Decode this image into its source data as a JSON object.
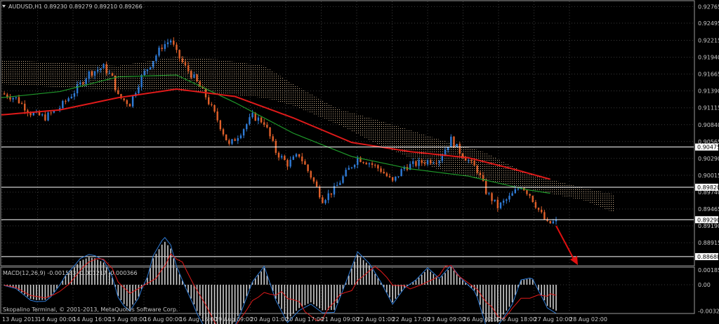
{
  "chart_data": [
    {
      "type": "candlestick",
      "title": "AUDUSD,H1  0.89230 0.89279 0.89210 0.89266",
      "symbol": "AUDUSD,H1",
      "ohlc_readout": "0.89230 0.89279 0.89210 0.89266",
      "ylim": [
        0.8855,
        0.9285
      ],
      "y_ticks": [
        "0.92765",
        "0.92495",
        "0.92215",
        "0.91940",
        "0.91665",
        "0.91390",
        "0.91115",
        "0.90840",
        "0.90565",
        "0.90290",
        "0.90015",
        "0.89740",
        "0.89465",
        "0.89190",
        "0.88915"
      ],
      "horizontal_levels": [
        "0.90475",
        "0.89820",
        "0.89290",
        "0.88688"
      ],
      "x_labels": [
        "13 Aug 2013",
        "14 Aug 00:00",
        "14 Aug 16:00",
        "15 Aug 08:00",
        "16 Aug 00:00",
        "16 Aug 16:00",
        "19 Aug 09:00",
        "20 Aug 01:00",
        "20 Aug 17:00",
        "21 Aug 09:00",
        "22 Aug 01:00",
        "22 Aug 17:00",
        "23 Aug 09:00",
        "26 Aug 02:00",
        "26 Aug 18:00",
        "27 Aug 10:00",
        "28 Aug 02:00"
      ],
      "indicators": [
        "Ichimoku cloud",
        "Moving average (red)",
        "Moving average (green)"
      ],
      "close_path": [
        [
          0,
          0.9135
        ],
        [
          5,
          0.9127
        ],
        [
          10,
          0.9103
        ],
        [
          15,
          0.9096
        ],
        [
          20,
          0.9112
        ],
        [
          25,
          0.9138
        ],
        [
          30,
          0.9168
        ],
        [
          35,
          0.9178
        ],
        [
          38,
          0.916
        ],
        [
          40,
          0.913
        ],
        [
          44,
          0.9118
        ],
        [
          48,
          0.9162
        ],
        [
          52,
          0.919
        ],
        [
          55,
          0.9212
        ],
        [
          58,
          0.9222
        ],
        [
          60,
          0.92
        ],
        [
          63,
          0.9178
        ],
        [
          66,
          0.916
        ],
        [
          70,
          0.913
        ],
        [
          74,
          0.9092
        ],
        [
          78,
          0.905
        ],
        [
          82,
          0.9072
        ],
        [
          86,
          0.9098
        ],
        [
          90,
          0.9088
        ],
        [
          94,
          0.904
        ],
        [
          98,
          0.902
        ],
        [
          102,
          0.9035
        ],
        [
          106,
          0.9
        ],
        [
          110,
          0.8962
        ],
        [
          114,
          0.8978
        ],
        [
          118,
          0.9005
        ],
        [
          122,
          0.903
        ],
        [
          126,
          0.9022
        ],
        [
          130,
          0.901
        ],
        [
          134,
          0.899
        ],
        [
          138,
          0.9015
        ],
        [
          142,
          0.902
        ],
        [
          146,
          0.9025
        ],
        [
          150,
          0.9028
        ],
        [
          154,
          0.906
        ],
        [
          157,
          0.904
        ],
        [
          160,
          0.9025
        ],
        [
          163,
          0.901
        ],
        [
          166,
          0.8975
        ],
        [
          170,
          0.895
        ],
        [
          174,
          0.8965
        ],
        [
          178,
          0.8985
        ],
        [
          181,
          0.897
        ],
        [
          184,
          0.8945
        ],
        [
          187,
          0.8922
        ],
        [
          190,
          0.8926
        ]
      ],
      "ma_red": [
        [
          0,
          0.91
        ],
        [
          20,
          0.9108
        ],
        [
          40,
          0.9128
        ],
        [
          60,
          0.9142
        ],
        [
          80,
          0.913
        ],
        [
          100,
          0.9095
        ],
        [
          120,
          0.9055
        ],
        [
          140,
          0.904
        ],
        [
          160,
          0.903
        ],
        [
          175,
          0.9012
        ],
        [
          188,
          0.8995
        ]
      ],
      "ma_green": [
        [
          0,
          0.9128
        ],
        [
          20,
          0.9138
        ],
        [
          40,
          0.9162
        ],
        [
          60,
          0.9165
        ],
        [
          80,
          0.912
        ],
        [
          100,
          0.907
        ],
        [
          120,
          0.9032
        ],
        [
          140,
          0.9012
        ],
        [
          160,
          0.9
        ],
        [
          180,
          0.8978
        ],
        [
          188,
          0.8972
        ]
      ],
      "cloud_upper": [
        [
          0,
          0.919
        ],
        [
          20,
          0.9185
        ],
        [
          40,
          0.918
        ],
        [
          60,
          0.9195
        ],
        [
          75,
          0.919
        ],
        [
          90,
          0.918
        ],
        [
          100,
          0.915
        ],
        [
          115,
          0.911
        ],
        [
          130,
          0.909
        ],
        [
          150,
          0.906
        ],
        [
          165,
          0.904
        ],
        [
          180,
          0.9005
        ],
        [
          200,
          0.898
        ],
        [
          210,
          0.897
        ]
      ],
      "cloud_lower": [
        [
          0,
          0.915
        ],
        [
          20,
          0.9145
        ],
        [
          40,
          0.914
        ],
        [
          60,
          0.914
        ],
        [
          75,
          0.9135
        ],
        [
          90,
          0.9128
        ],
        [
          100,
          0.9115
        ],
        [
          115,
          0.9085
        ],
        [
          130,
          0.905
        ],
        [
          150,
          0.901
        ],
        [
          165,
          0.8995
        ],
        [
          180,
          0.898
        ],
        [
          200,
          0.896
        ],
        [
          210,
          0.894
        ]
      ]
    },
    {
      "type": "histogram",
      "title": "MACD(12,26,9) -0.001583 -0.001217 -0.000366",
      "y_ticks": [
        "0.001853",
        "0.00",
        "-0.003272"
      ],
      "ylim": [
        -0.0035,
        0.0021
      ]
    }
  ],
  "footer": {
    "copyright": "Skopalino Terminal, © 2001-2013, MetaQuotes Software Corp."
  },
  "colors": {
    "bg": "#000000",
    "grid": "#3a3a3a",
    "bull": "#2f7bd6",
    "bear": "#e0602a",
    "ma_red": "#e01a1a",
    "ma_green": "#1f9a2a",
    "cloud": "#e8c8a0",
    "levels": "#ffffff",
    "macd_hist": "#d0d0d0",
    "arrow": "#e01010"
  }
}
